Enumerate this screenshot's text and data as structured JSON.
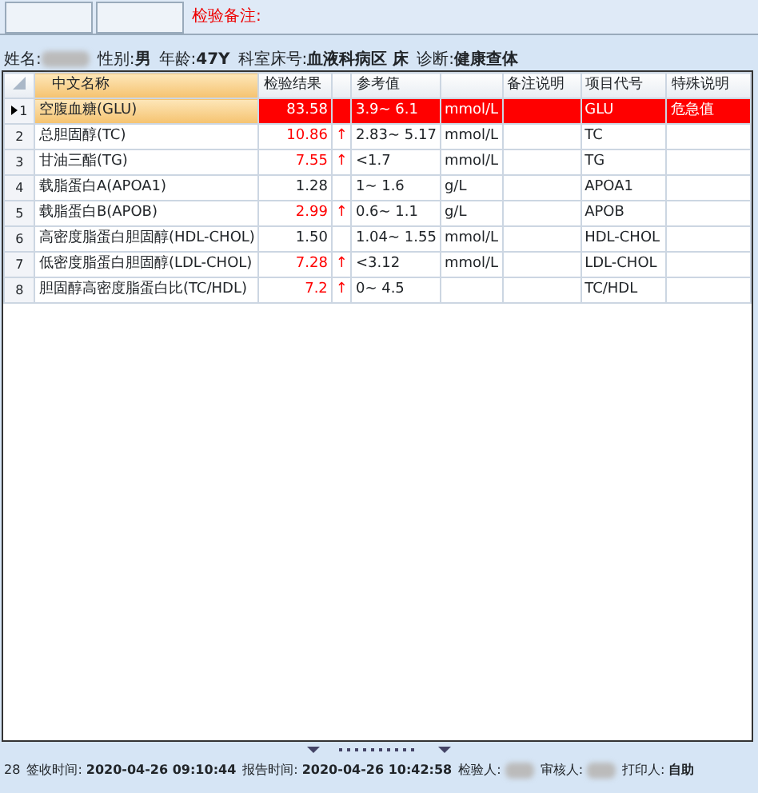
{
  "top_strip": {
    "buttons": [
      {
        "kind": "blank"
      },
      {
        "kind": "blank"
      }
    ],
    "note_label": "检验备注:"
  },
  "patient": [
    {
      "label": "姓名:",
      "blurred": true
    },
    {
      "label": "性别:",
      "value": "男"
    },
    {
      "label": "年龄:",
      "value": "47Y"
    },
    {
      "label": "科室床号:",
      "value": "血液科病区 床"
    },
    {
      "label": "诊断:",
      "value": "健康查体"
    }
  ],
  "table": {
    "columns": [
      "中文名称",
      "检验结果",
      "",
      "参考值",
      "",
      "备注说明",
      "项目代号",
      "特殊说明"
    ],
    "rows": [
      {
        "index": "1",
        "name": "空腹血糖(GLU)",
        "result": "83.58",
        "high": true,
        "flag": "",
        "reference": "3.9~ 6.1",
        "unit": "mmol/L",
        "note": "",
        "code": "GLU",
        "special": "危急值",
        "selected": true,
        "critical": true
      },
      {
        "index": "2",
        "name": "总胆固醇(TC)",
        "result": "10.86",
        "high": true,
        "flag": "↑",
        "reference": "2.83~ 5.17",
        "unit": "mmol/L",
        "note": "",
        "code": "TC",
        "special": "",
        "selected": false,
        "critical": false
      },
      {
        "index": "3",
        "name": "甘油三酯(TG)",
        "result": "7.55",
        "high": true,
        "flag": "↑",
        "reference": "<1.7",
        "unit": "mmol/L",
        "note": "",
        "code": "TG",
        "special": "",
        "selected": false,
        "critical": false
      },
      {
        "index": "4",
        "name": "载脂蛋白A(APOA1)",
        "result": "1.28",
        "high": false,
        "flag": "",
        "reference": "1~ 1.6",
        "unit": "g/L",
        "note": "",
        "code": "APOA1",
        "special": "",
        "selected": false,
        "critical": false
      },
      {
        "index": "5",
        "name": "载脂蛋白B(APOB)",
        "result": "2.99",
        "high": true,
        "flag": "↑",
        "reference": "0.6~ 1.1",
        "unit": "g/L",
        "note": "",
        "code": "APOB",
        "special": "",
        "selected": false,
        "critical": false
      },
      {
        "index": "6",
        "name": "高密度脂蛋白胆固醇(HDL-CHOL)",
        "result": "1.50",
        "high": false,
        "flag": "",
        "reference": "1.04~ 1.55",
        "unit": "mmol/L",
        "note": "",
        "code": "HDL-CHOL",
        "special": "",
        "selected": false,
        "critical": false
      },
      {
        "index": "7",
        "name": "低密度脂蛋白胆固醇(LDL-CHOL)",
        "result": "7.28",
        "high": true,
        "flag": "↑",
        "reference": "<3.12",
        "unit": "mmol/L",
        "note": "",
        "code": "LDL-CHOL",
        "special": "",
        "selected": false,
        "critical": false
      },
      {
        "index": "8",
        "name": "胆固醇高密度脂蛋白比(TC/HDL)",
        "result": "7.2",
        "high": true,
        "flag": "↑",
        "reference": "0~ 4.5",
        "unit": "",
        "note": "",
        "code": "TC/HDL",
        "special": "",
        "selected": false,
        "critical": false
      }
    ]
  },
  "status_bar": [
    {
      "label": "28"
    },
    {
      "label": "签收时间:",
      "value": "2020-04-26  09:10:44"
    },
    {
      "label": "报告时间:",
      "value": "2020-04-26  10:42:58"
    },
    {
      "label": "检验人:",
      "blurred": true
    },
    {
      "label": "审核人:",
      "blurred": true
    },
    {
      "label": "打印人:",
      "value": "自助"
    }
  ]
}
